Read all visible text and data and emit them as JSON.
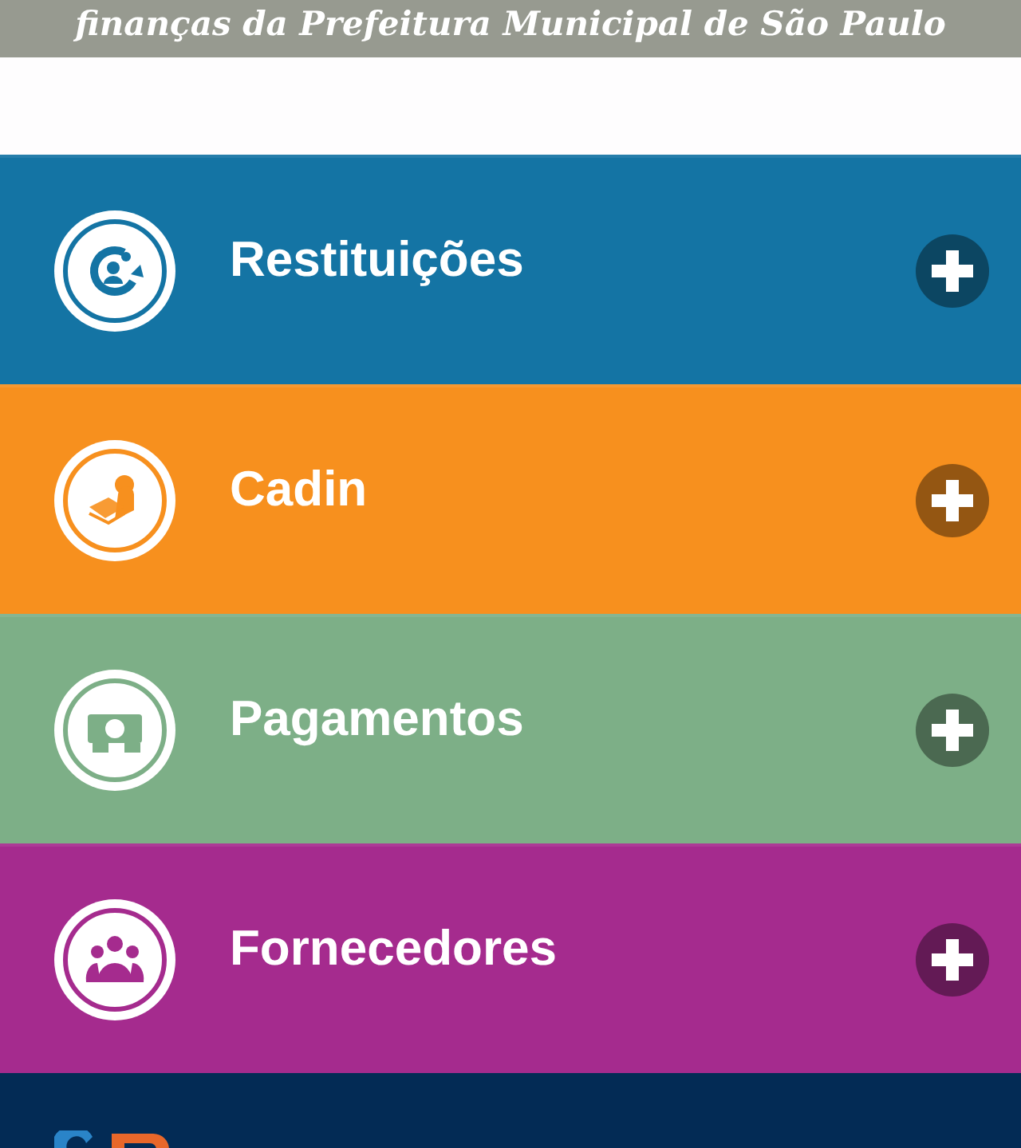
{
  "header": {
    "subtitle": "finanças da Prefeitura Municipal de São Paulo"
  },
  "menu": [
    {
      "label": "Restituições",
      "kind": "refund",
      "color": "#1474a4"
    },
    {
      "label": "Cadin",
      "kind": "debtor",
      "color": "#f7901e"
    },
    {
      "label": "Pagamentos",
      "kind": "cash",
      "color": "#7daf87"
    },
    {
      "label": "Fornecedores",
      "kind": "group",
      "color": "#a52b8e"
    }
  ]
}
